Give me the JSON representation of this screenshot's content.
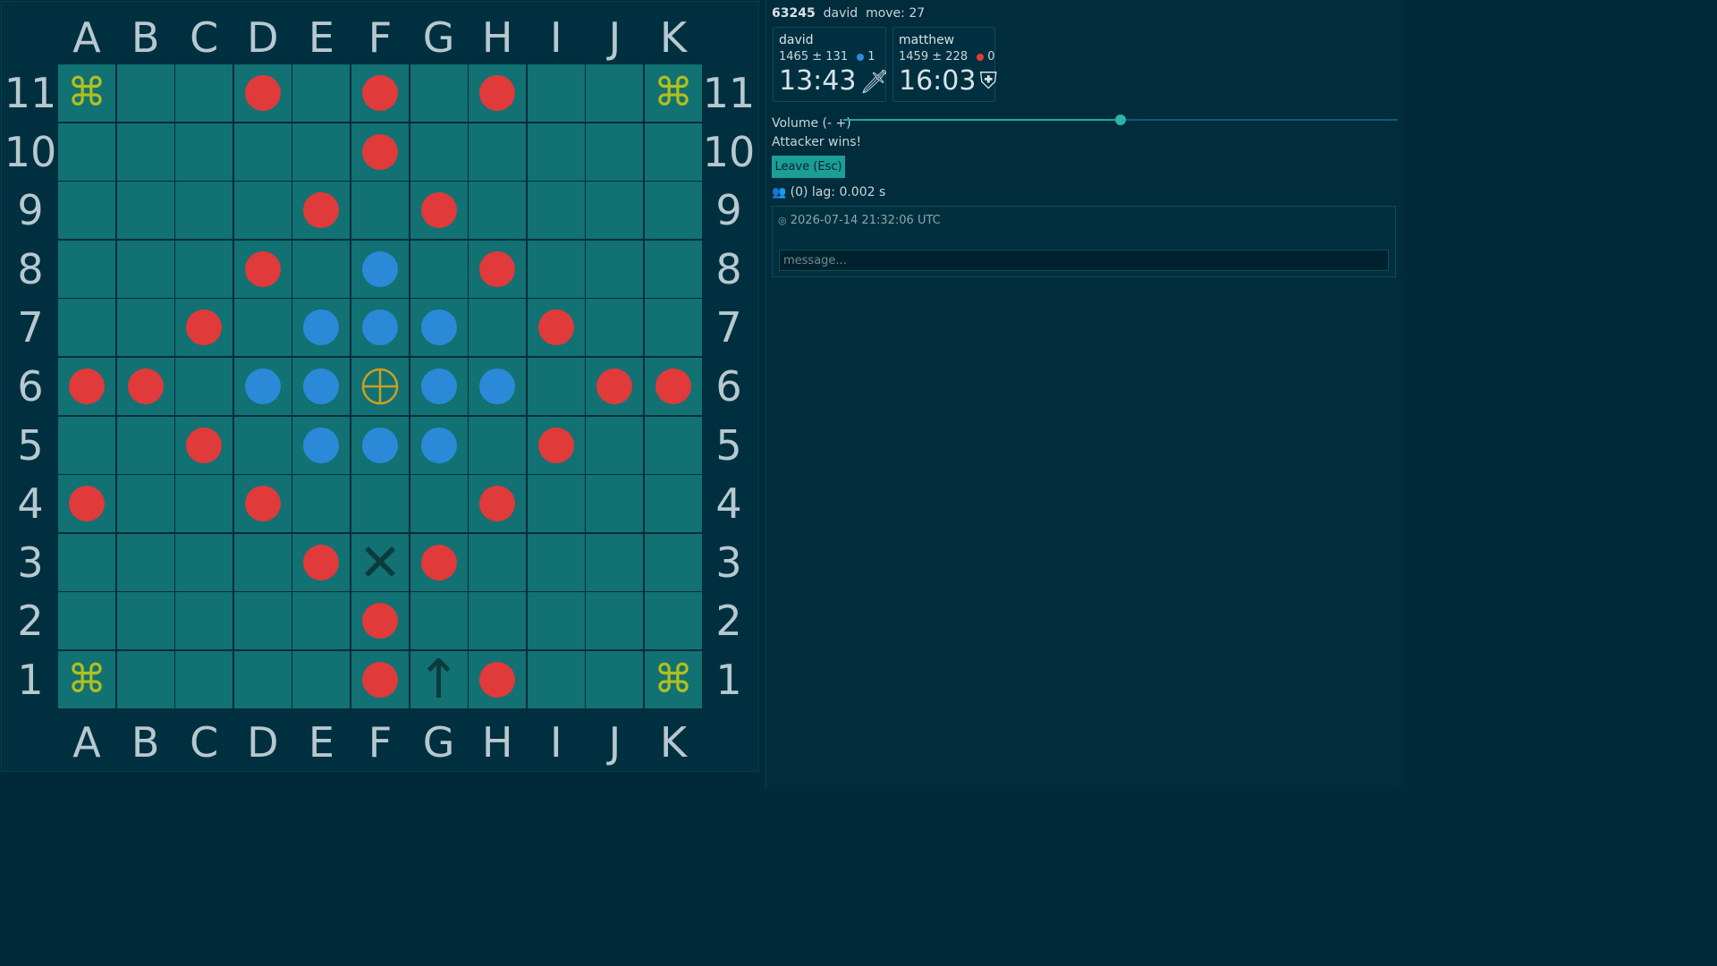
{
  "board": {
    "columns": [
      "A",
      "B",
      "C",
      "D",
      "E",
      "F",
      "G",
      "H",
      "I",
      "J",
      "K"
    ],
    "rows": [
      "11",
      "10",
      "9",
      "8",
      "7",
      "6",
      "5",
      "4",
      "3",
      "2",
      "1"
    ],
    "pieces": [
      {
        "sq": "D11",
        "color": "red"
      },
      {
        "sq": "F11",
        "color": "red"
      },
      {
        "sq": "H11",
        "color": "red"
      },
      {
        "sq": "F10",
        "color": "red"
      },
      {
        "sq": "E9",
        "color": "red"
      },
      {
        "sq": "G9",
        "color": "red"
      },
      {
        "sq": "D8",
        "color": "red"
      },
      {
        "sq": "F8",
        "color": "blue"
      },
      {
        "sq": "H8",
        "color": "red"
      },
      {
        "sq": "C7",
        "color": "red"
      },
      {
        "sq": "E7",
        "color": "blue"
      },
      {
        "sq": "F7",
        "color": "blue"
      },
      {
        "sq": "G7",
        "color": "blue"
      },
      {
        "sq": "I7",
        "color": "red"
      },
      {
        "sq": "A6",
        "color": "red"
      },
      {
        "sq": "B6",
        "color": "red"
      },
      {
        "sq": "D6",
        "color": "blue"
      },
      {
        "sq": "E6",
        "color": "blue"
      },
      {
        "sq": "G6",
        "color": "blue"
      },
      {
        "sq": "H6",
        "color": "blue"
      },
      {
        "sq": "J6",
        "color": "red"
      },
      {
        "sq": "K6",
        "color": "red"
      },
      {
        "sq": "C5",
        "color": "red"
      },
      {
        "sq": "E5",
        "color": "blue"
      },
      {
        "sq": "F5",
        "color": "blue"
      },
      {
        "sq": "G5",
        "color": "blue"
      },
      {
        "sq": "I5",
        "color": "red"
      },
      {
        "sq": "A4",
        "color": "red"
      },
      {
        "sq": "D4",
        "color": "red"
      },
      {
        "sq": "H4",
        "color": "red"
      },
      {
        "sq": "E3",
        "color": "red"
      },
      {
        "sq": "G3",
        "color": "red"
      },
      {
        "sq": "F2",
        "color": "red"
      },
      {
        "sq": "F1",
        "color": "red"
      },
      {
        "sq": "H1",
        "color": "red"
      }
    ],
    "marks": [
      {
        "sq": "A11",
        "glyph": "⌘",
        "kind": "corner-mark",
        "icon": "corner-icon"
      },
      {
        "sq": "K11",
        "glyph": "⌘",
        "kind": "corner-mark",
        "icon": "corner-icon"
      },
      {
        "sq": "A1",
        "glyph": "⌘",
        "kind": "corner-mark",
        "icon": "corner-icon"
      },
      {
        "sq": "K1",
        "glyph": "⌘",
        "kind": "corner-mark",
        "icon": "corner-icon"
      },
      {
        "sq": "F3",
        "glyph": "✕",
        "kind": "last-move-mark",
        "icon": "capture-x-icon"
      },
      {
        "sq": "G1",
        "glyph": "↑",
        "kind": "arrow-mark",
        "icon": "move-arrow-icon"
      }
    ],
    "throne": {
      "sq": "F6",
      "icon": "throne-icon"
    },
    "colors": {
      "red": "#e03a3a",
      "blue": "#2a8ad8",
      "square": "#127173",
      "gold": "#c8a020"
    }
  },
  "header": {
    "game_id": "63245",
    "user": "david",
    "move_label": "move: 27"
  },
  "players": [
    {
      "name": "david",
      "rating": "1465",
      "plusminus": "±",
      "deviation": "131",
      "captures": "1",
      "color": "blue",
      "clock": "13:43",
      "icon": "dagger-icon",
      "glyph": "🗡"
    },
    {
      "name": "matthew",
      "rating": "1459",
      "plusminus": "±",
      "deviation": "228",
      "captures": "0",
      "color": "red",
      "clock": "16:03",
      "icon": "shield-icon",
      "glyph": "⛨"
    }
  ],
  "volume": {
    "label": "Volume (- +)",
    "level": 0.5
  },
  "status": {
    "result": "Attacker wins!"
  },
  "leave": {
    "label": "Leave (Esc)"
  },
  "lag": {
    "text": "(0) lag: 0.002 s",
    "icon": "users-icon"
  },
  "chat": {
    "icon": "clock-icon",
    "timestamp": "2026-07-14 21:32:06 UTC",
    "placeholder": "message..."
  }
}
